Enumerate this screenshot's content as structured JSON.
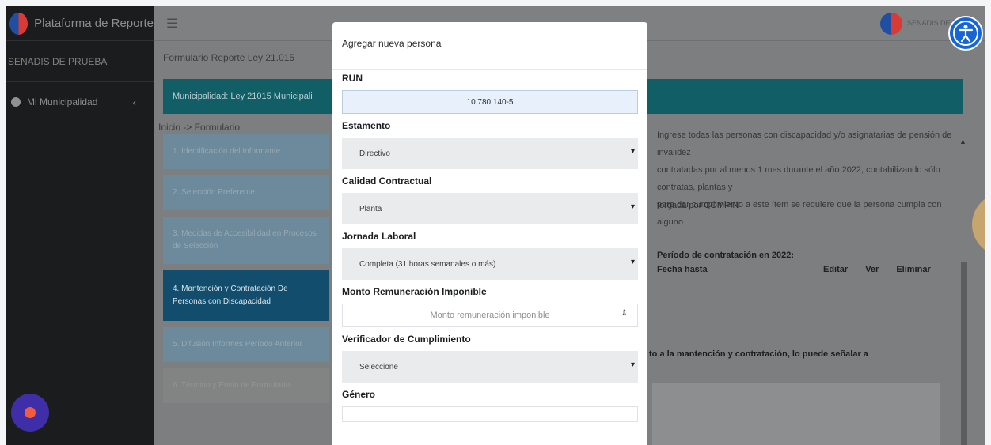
{
  "app": {
    "brand": "Plataforma de Reporte",
    "user_label": "SENADIS DE PRUEBA",
    "nav_item": "Mi Municipalidad",
    "topbar_user": "SENADIS DE P"
  },
  "page": {
    "form_title": "Formulario Reporte Ley 21.015",
    "banner": "Municipalidad: Ley 21015 Municipali",
    "breadcrumb": "Inicio -> Formulario",
    "steps": [
      "1. Identificación del Informante",
      "2. Selección Preferente",
      "3. Medidas de Accesibilidad en Procesos de Selección",
      "4. Mantención y Contratación De Personas con Discapacidad",
      "5. Difusión Informes Período Anterior",
      "6. Término y Envío de Formulario"
    ],
    "right_text_lines": [
      "Ingrese todas las personas con discapacidad y/o asignatarias de pensión de invalidez",
      "contratadas por al menos 1 mes durante el año 2022, contabilizando sólo contratas, plantas y",
      "para dar cumplimiento a este ítem se requiere que la persona cumpla con alguno"
    ],
    "compin_text": "torgada por COMPIN",
    "table": {
      "period_heading": "Período de contratación en 2022:",
      "fecha_hasta": "Fecha hasta",
      "editar": "Editar",
      "ver": "Ver",
      "eliminar": "Eliminar"
    },
    "bottom_text": "to a la mantención y contratación, lo puede señalar a"
  },
  "modal": {
    "title": "Agregar nueva persona",
    "run_label": "RUN",
    "run_value": "10.780.140-5",
    "estamento_label": "Estamento",
    "estamento_value": "Directivo",
    "calidad_label": "Calidad Contractual",
    "calidad_value": "Planta",
    "jornada_label": "Jornada Laboral",
    "jornada_value": "Completa (31 horas semanales o más)",
    "monto_label": "Monto Remuneración Imponible",
    "monto_placeholder": "Monto remuneración imponible",
    "verificador_label": "Verificador de Cumplimiento",
    "verificador_value": "Seleccione",
    "genero_label": "Género"
  },
  "colors": {
    "banner": "#125e67",
    "active_step": "#124d6d",
    "access_button": "#1565d8",
    "help_bubble": "#3e2ea8"
  },
  "icons": [
    "hamburger-icon",
    "accessibility-icon",
    "chevron-left-icon",
    "chevron-down-icon",
    "spinner-icon",
    "chat-bubble-icon"
  ]
}
